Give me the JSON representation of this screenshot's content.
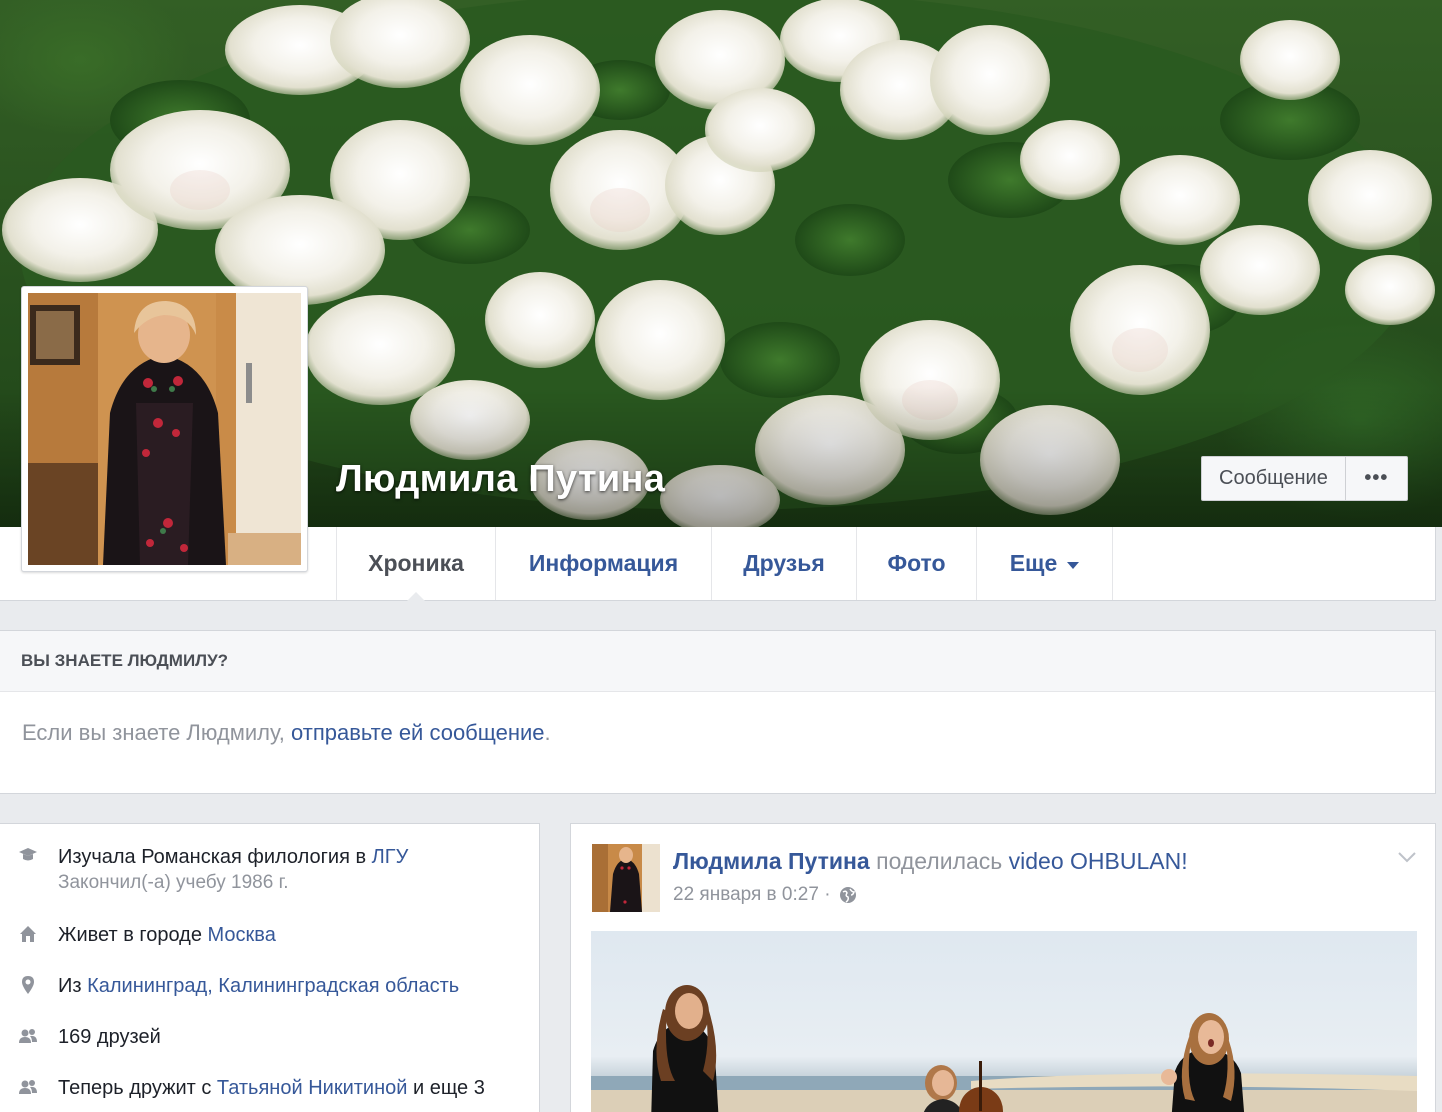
{
  "profile": {
    "name": "Людмила Путина"
  },
  "cover_actions": {
    "message_label": "Сообщение",
    "more_label": "•••"
  },
  "nav": {
    "tabs": [
      {
        "label": "Хроника",
        "active": true
      },
      {
        "label": "Информация"
      },
      {
        "label": "Друзья"
      },
      {
        "label": "Фото"
      },
      {
        "label": "Еще"
      }
    ]
  },
  "know_box": {
    "heading": "ВЫ ЗНАЕТЕ ЛЮДМИЛУ?",
    "text_prefix": "Если вы знаете Людмилу, ",
    "link": "отправьте ей сообщение",
    "text_suffix": "."
  },
  "intro": {
    "education": {
      "prefix": "Изучала Романская филология в ",
      "school": "ЛГУ",
      "sub": "Закончил(-а) учебу 1986 г."
    },
    "lives": {
      "prefix": "Живет в городе ",
      "city": "Москва"
    },
    "from": {
      "prefix": "Из ",
      "place": "Калининград, Калининградская область"
    },
    "friends": "169 друзей",
    "friends_with": {
      "prefix": "Теперь дружит с ",
      "name": "Татьяной Никитиной",
      "suffix": " и еще 3"
    }
  },
  "post": {
    "author": "Людмила Путина",
    "action": " поделилась ",
    "target": "video OHBULAN!",
    "timestamp": "22 января в 0:27 ·"
  },
  "icons": {
    "education": "graduation-cap-icon",
    "lives": "house-icon",
    "from": "map-pin-icon",
    "friends": "friends-icon",
    "friends_with": "friends-icon",
    "privacy": "globe-icon",
    "post_menu": "chevron-down-icon",
    "more_tab": "caret-down-icon"
  },
  "colors": {
    "link": "#365899",
    "muted": "#90949c",
    "text": "#1d2129",
    "background": "#e9ebee"
  }
}
